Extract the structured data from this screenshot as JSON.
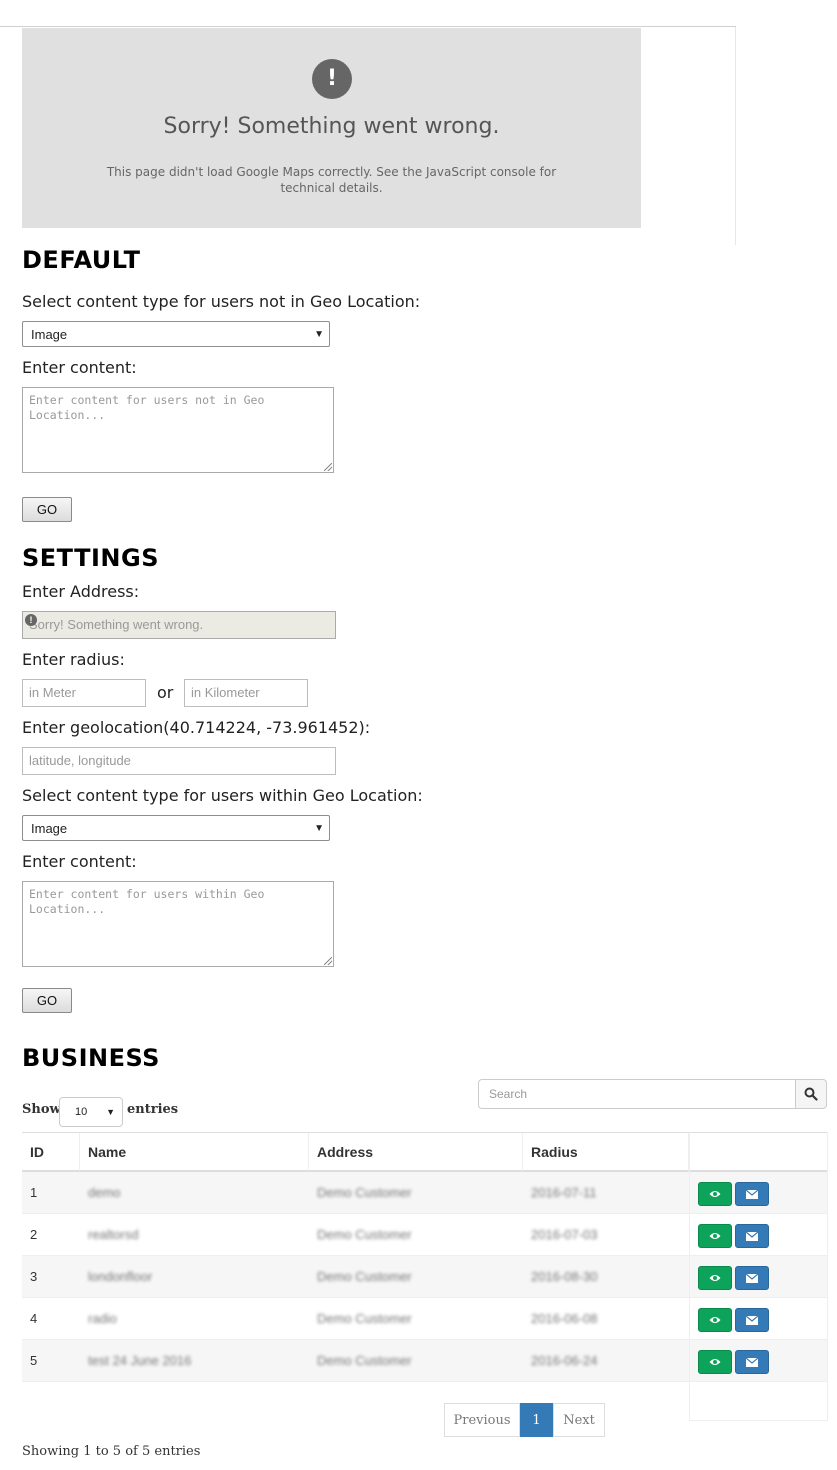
{
  "map_error": {
    "icon": "!",
    "title": "Sorry! Something went wrong.",
    "message": "This page didn't load Google Maps correctly. See the JavaScript console for technical details."
  },
  "default_section": {
    "heading": "DEFAULT",
    "content_type_label": "Select content type for users not in Geo Location:",
    "content_type_value": "Image",
    "content_label": "Enter content:",
    "content_placeholder": "Enter content for users not in Geo Location...",
    "go_label": "GO"
  },
  "settings_section": {
    "heading": "SETTINGS",
    "address_label": "Enter Address:",
    "address_value": "Sorry! Something went wrong.",
    "radius_label": "Enter radius:",
    "meter_placeholder": "in Meter",
    "or_text": "or",
    "km_placeholder": "in Kilometer",
    "geolocation_label": "Enter geolocation(40.714224, -73.961452):",
    "geolocation_placeholder": "latitude, longitude",
    "content_type_label": "Select content type for users within Geo Location:",
    "content_type_value": "Image",
    "content_label": "Enter content:",
    "content_placeholder": "Enter content for users within Geo Location...",
    "go_label": "GO"
  },
  "business_section": {
    "heading": "BUSINESS",
    "show_label": "Show",
    "entries_label": "entries",
    "page_length": "10",
    "search_placeholder": "Search",
    "columns": [
      "ID",
      "Name",
      "Address",
      "Radius"
    ],
    "rows": [
      {
        "id": "1",
        "name": "demo",
        "address": "Demo Customer",
        "radius": "2016-07-11"
      },
      {
        "id": "2",
        "name": "realtorsd",
        "address": "Demo Customer",
        "radius": "2016-07-03"
      },
      {
        "id": "3",
        "name": "londonfloor",
        "address": "Demo Customer",
        "radius": "2016-08-30"
      },
      {
        "id": "4",
        "name": "radio",
        "address": "Demo Customer",
        "radius": "2016-06-08"
      },
      {
        "id": "5",
        "name": "test 24 June 2016",
        "address": "Demo Customer",
        "radius": "2016-06-24"
      }
    ],
    "pagination": {
      "previous": "Previous",
      "current": "1",
      "next": "Next"
    },
    "info": "Showing 1 to 5 of 5 entries"
  },
  "colors": {
    "view_button": "#0da35a",
    "mail_button": "#337ab7",
    "active_page": "#337ab7"
  },
  "icons": {
    "view": "eye-icon",
    "mail": "envelope-icon",
    "search": "search-icon",
    "error": "exclamation-icon"
  }
}
